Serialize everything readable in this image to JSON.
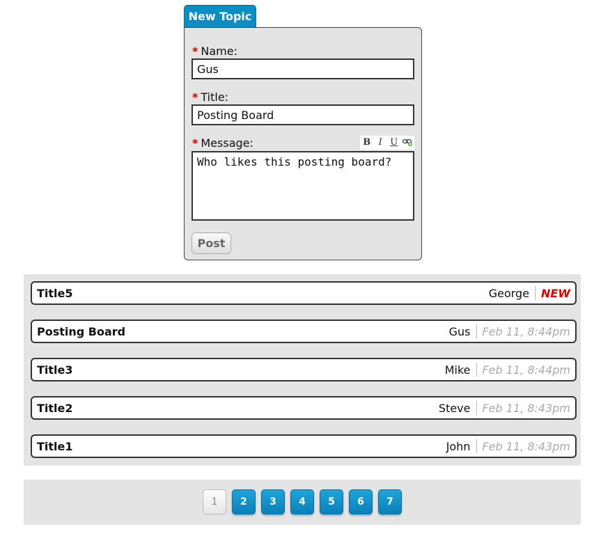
{
  "form": {
    "tab_label": "New Topic",
    "required_marker": "*",
    "name_label": "Name:",
    "name_value": "Gus",
    "title_label": "Title:",
    "title_value": "Posting Board",
    "message_label": "Message:",
    "message_value": "Who likes this posting board?",
    "toolbar": {
      "bold": "B",
      "italic": "I",
      "underline": "U",
      "link_icon": "link-icon"
    },
    "post_label": "Post"
  },
  "topics": [
    {
      "title": "Title5",
      "author": "George",
      "status": "NEW"
    },
    {
      "title": "Posting Board",
      "author": "Gus",
      "date": "Feb 11, 8:44pm"
    },
    {
      "title": "Title3",
      "author": "Mike",
      "date": "Feb 11, 8:44pm"
    },
    {
      "title": "Title2",
      "author": "Steve",
      "date": "Feb 11, 8:43pm"
    },
    {
      "title": "Title1",
      "author": "John",
      "date": "Feb 11, 8:43pm"
    }
  ],
  "pagination": {
    "pages": [
      "1",
      "2",
      "3",
      "4",
      "5",
      "6",
      "7"
    ],
    "current": "1"
  },
  "colors": {
    "accent": "#0a8ec6",
    "required": "#d10000",
    "new_badge": "#e00000",
    "panel_bg": "#e4e4e4"
  }
}
